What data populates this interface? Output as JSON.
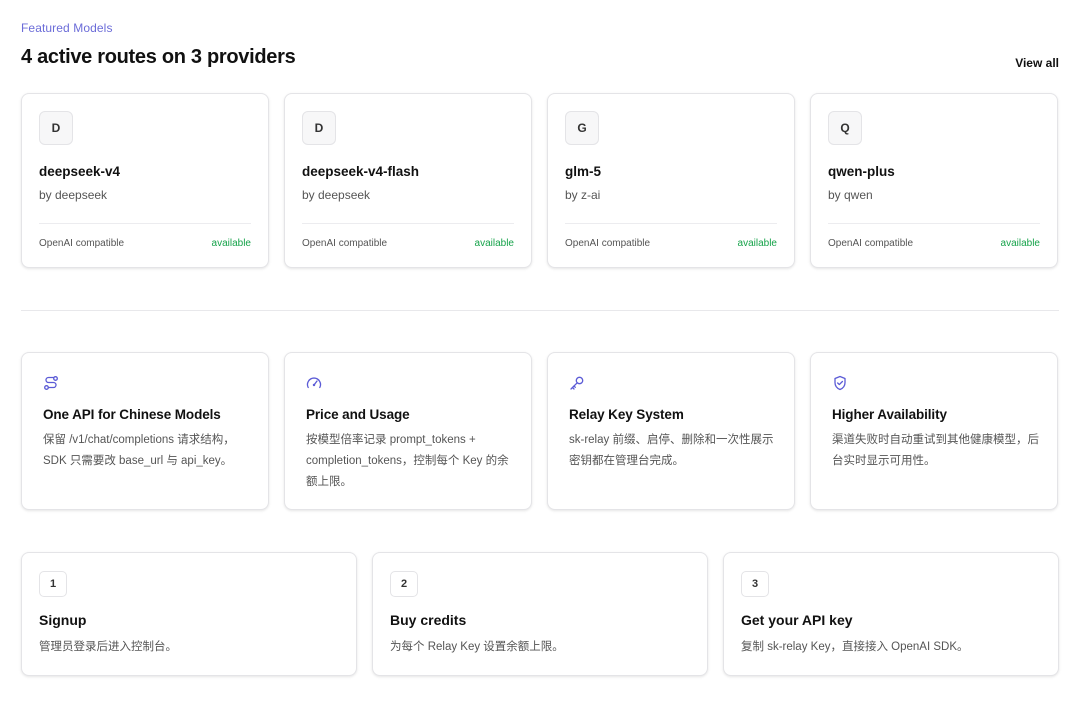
{
  "header": {
    "eyebrow": "Featured Models",
    "title": "4 active routes on 3 providers",
    "view_all": "View all"
  },
  "models": [
    {
      "badge": "D",
      "name": "deepseek-v4",
      "by": "by deepseek",
      "compat": "OpenAI compatible",
      "status": "available"
    },
    {
      "badge": "D",
      "name": "deepseek-v4-flash",
      "by": "by deepseek",
      "compat": "OpenAI compatible",
      "status": "available"
    },
    {
      "badge": "G",
      "name": "glm-5",
      "by": "by z-ai",
      "compat": "OpenAI compatible",
      "status": "available"
    },
    {
      "badge": "Q",
      "name": "qwen-plus",
      "by": "by qwen",
      "compat": "OpenAI compatible",
      "status": "available"
    }
  ],
  "features": [
    {
      "icon": "route-icon",
      "title": "One API for Chinese Models",
      "desc": "保留 /v1/chat/completions 请求结构，SDK 只需要改 base_url 与 api_key。"
    },
    {
      "icon": "gauge-icon",
      "title": "Price and Usage",
      "desc": "按模型倍率记录 prompt_tokens + completion_tokens，控制每个 Key 的余额上限。"
    },
    {
      "icon": "key-icon",
      "title": "Relay Key System",
      "desc": "sk-relay 前缀、启停、删除和一次性展示密钥都在管理台完成。"
    },
    {
      "icon": "shield-check-icon",
      "title": "Higher Availability",
      "desc": "渠道失败时自动重试到其他健康模型，后台实时显示可用性。"
    }
  ],
  "steps": [
    {
      "num": "1",
      "title": "Signup",
      "desc": "管理员登录后进入控制台。"
    },
    {
      "num": "2",
      "title": "Buy credits",
      "desc": "为每个 Relay Key 设置余额上限。"
    },
    {
      "num": "3",
      "title": "Get your API key",
      "desc": "复制 sk-relay Key，直接接入 OpenAI SDK。"
    }
  ],
  "colors": {
    "accent": "#6b6cd8",
    "available": "#16a34a",
    "icon": "#5b5bd6"
  }
}
